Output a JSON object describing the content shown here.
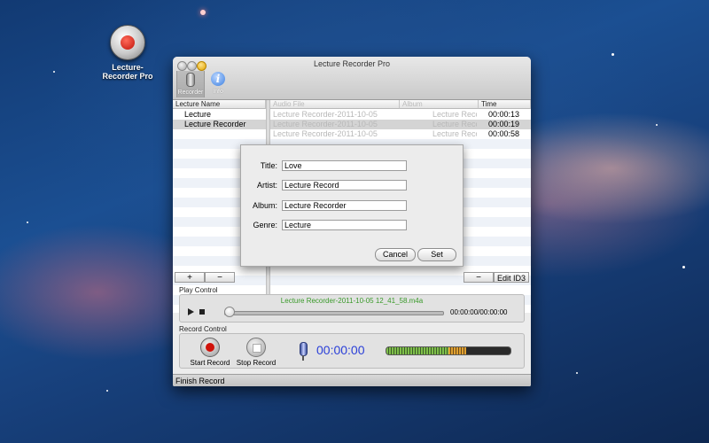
{
  "desktop": {
    "icon_label_line1": "Lecture-",
    "icon_label_line2": "Recorder Pro"
  },
  "window": {
    "title": "Lecture Recorder Pro",
    "toolbar": [
      {
        "label": "Recorder",
        "icon": "microphone-icon",
        "selected": true
      },
      {
        "label": "Info",
        "icon": "info-icon",
        "selected": false
      }
    ]
  },
  "left_table": {
    "header": "Lecture Name",
    "rows": [
      "Lecture",
      "Lecture Recorder"
    ]
  },
  "right_table": {
    "headers": [
      "Audio File",
      "Album",
      "Time"
    ],
    "rows": [
      {
        "file": "Lecture Recorder-2011-10-05",
        "album": "Lecture Recorder",
        "time": "00:00:13"
      },
      {
        "file": "Lecture Recorder-2011-10-05",
        "album": "Lecture Recorder",
        "time": "00:00:19"
      },
      {
        "file": "Lecture Recorder-2011-10-05",
        "album": "Lecture Recorder",
        "time": "00:00:58"
      }
    ]
  },
  "dialog": {
    "title_label": "Title:",
    "title_value": "Love",
    "artist_label": "Artist:",
    "artist_value": "Lecture Record",
    "album_label": "Album:",
    "album_value": "Lecture Recorder",
    "genre_label": "Genre:",
    "genre_value": "Lecture",
    "cancel_label": "Cancel",
    "set_label": "Set"
  },
  "list_buttons": {
    "add": "+",
    "remove": "−",
    "remove_file": "−",
    "edit_id3": "Edit ID3"
  },
  "play_control": {
    "label": "Play Control",
    "filename": "Lecture Recorder-2011-10-05 12_41_58.m4a",
    "time": "00:00:00/00:00:00",
    "progress": 0,
    "filename_color": "#3a9a2a"
  },
  "record_control": {
    "label": "Record Control",
    "start_label": "Start Record",
    "stop_label": "Stop Record",
    "timer": "00:00:00",
    "timer_color": "#2a3fd8"
  },
  "status": {
    "text": "Finish Record"
  }
}
